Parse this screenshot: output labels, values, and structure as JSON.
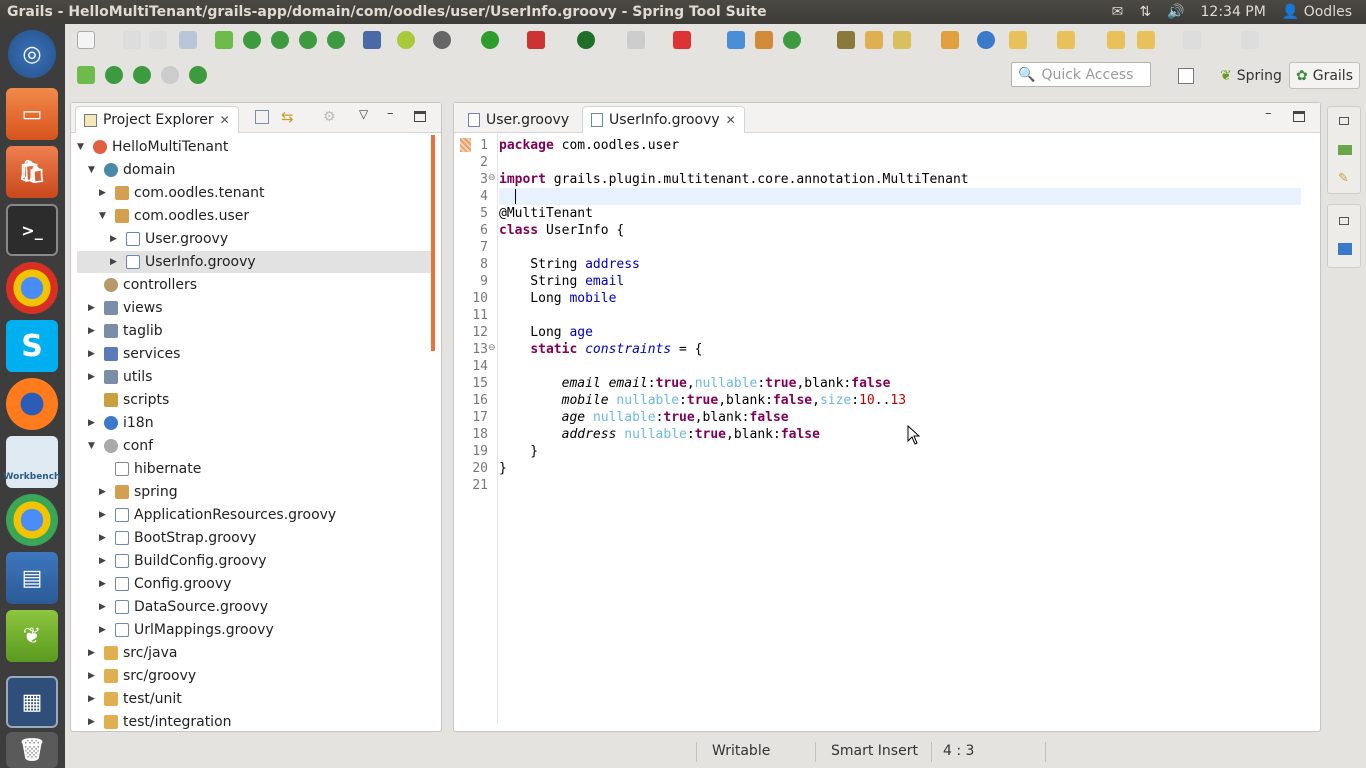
{
  "window": {
    "title": "Grails - HelloMultiTenant/grails-app/domain/com/oodles/user/UserInfo.groovy - Spring Tool Suite",
    "clock": "12:34 PM",
    "user": "Oodles"
  },
  "launcher": {
    "workbench_label": "Workbench",
    "icons": [
      "ubuntu-dash-icon",
      "files-icon",
      "software-center-icon",
      "terminal-icon",
      "chrome-icon",
      "skype-icon",
      "firefox-icon",
      "mysql-workbench-icon",
      "chrome-icon",
      "writer-icon",
      "spring-tool-suite-icon",
      "workspace-switcher-icon",
      "trash-icon"
    ]
  },
  "toolbar": {
    "quick_access_placeholder": "Quick Access",
    "perspectives": {
      "spring": "Spring",
      "grails": "Grails"
    }
  },
  "explorer": {
    "tab_label": "Project Explorer",
    "tree": [
      {
        "label": "HelloMultiTenant"
      },
      {
        "label": "domain"
      },
      {
        "label": "com.oodles.tenant"
      },
      {
        "label": "com.oodles.user"
      },
      {
        "label": "User.groovy"
      },
      {
        "label": "UserInfo.groovy"
      },
      {
        "label": "controllers"
      },
      {
        "label": "views"
      },
      {
        "label": "taglib"
      },
      {
        "label": "services"
      },
      {
        "label": "utils"
      },
      {
        "label": "scripts"
      },
      {
        "label": "i18n"
      },
      {
        "label": "conf"
      },
      {
        "label": "hibernate"
      },
      {
        "label": "spring"
      },
      {
        "label": "ApplicationResources.groovy"
      },
      {
        "label": "BootStrap.groovy"
      },
      {
        "label": "BuildConfig.groovy"
      },
      {
        "label": "Config.groovy"
      },
      {
        "label": "DataSource.groovy"
      },
      {
        "label": "UrlMappings.groovy"
      },
      {
        "label": "src/java"
      },
      {
        "label": "src/groovy"
      },
      {
        "label": "test/unit"
      },
      {
        "label": "test/integration"
      }
    ]
  },
  "editor": {
    "tabs": [
      {
        "label": "User.groovy"
      },
      {
        "label": "UserInfo.groovy"
      }
    ],
    "line_numbers": [
      "1",
      "2",
      "3",
      "4",
      "5",
      "6",
      "7",
      "8",
      "9",
      "10",
      "11",
      "12",
      "13",
      "14",
      "15",
      "16",
      "17",
      "18",
      "19",
      "20",
      "21"
    ]
  },
  "status": {
    "writable": "Writable",
    "insert_mode": "Smart Insert",
    "position": "4 : 3"
  }
}
